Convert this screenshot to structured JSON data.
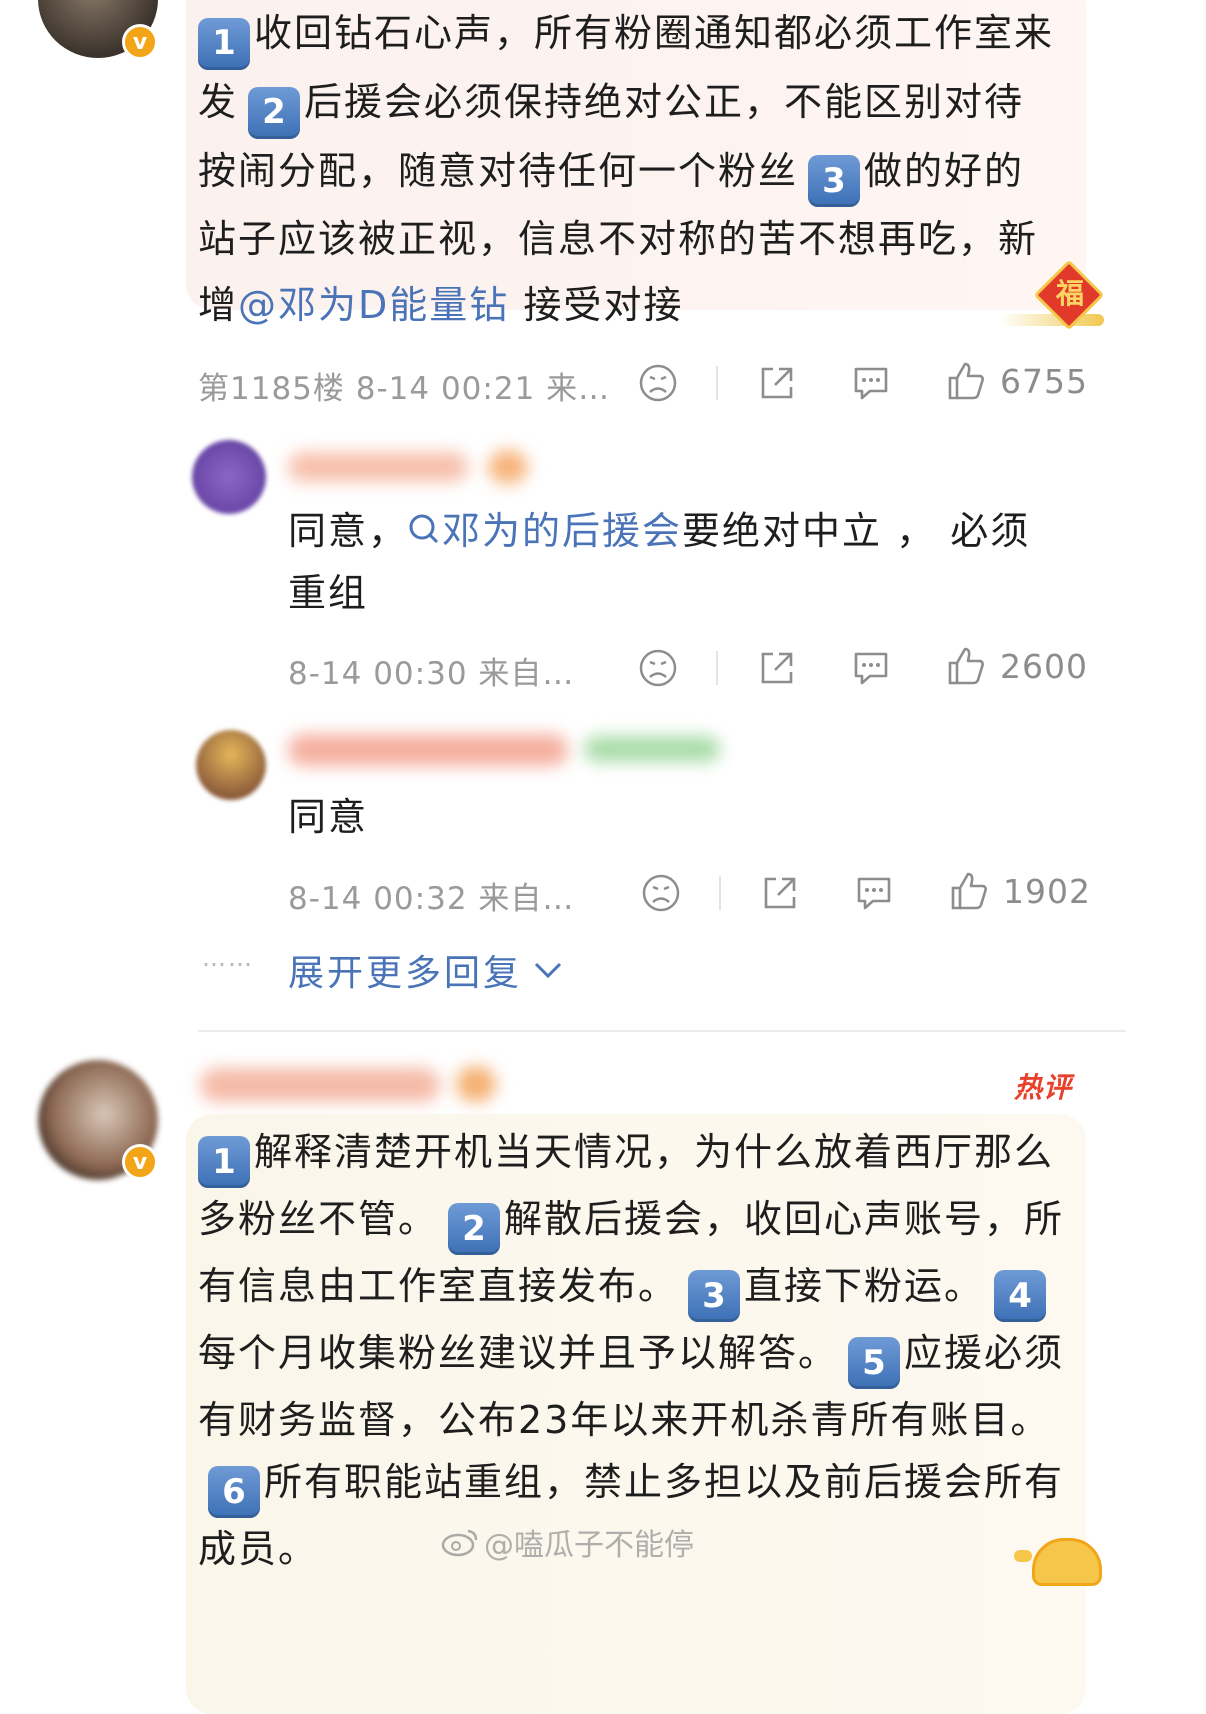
{
  "comment1": {
    "paragraphs": {
      "n1": "1",
      "t1": "收回钻石心声，所有粉圈通知都必须工作室来发",
      "n2": "2",
      "t2": "后援会必须保持绝对公正，不能区别对待按闹分配，随意对待任何一个粉丝",
      "n3": "3",
      "t3": "做的好的站子应该被正视，信息不对称的苦不想再吃，新增",
      "mention": "@邓为D能量钻",
      "t4": " 接受对接"
    },
    "meta": "第1185楼 8-14 00:21 来…",
    "likes": "6755",
    "sticker": "福"
  },
  "reply1": {
    "prefix": "同意，",
    "search_link": "邓为的后援会",
    "suffix": "要绝对中立 ，  必须重组",
    "meta": "8-14 00:30 来自…",
    "likes": "2600"
  },
  "reply2": {
    "text": "同意",
    "meta": "8-14 00:32 来自…",
    "likes": "1902"
  },
  "more_replies": {
    "dots": "……",
    "label": "展开更多回复"
  },
  "comment2": {
    "hot_badge": "热评",
    "paragraphs": {
      "n1": "1",
      "t1": "解释清楚开机当天情况，为什么放着西厅那么多粉丝不管。",
      "n2": "2",
      "t2": "解散后援会，收回心声账号，所有信息由工作室直接发布。",
      "n3": "3",
      "t3": "直接下粉运。",
      "n4": "4",
      "t4": "每个月收集粉丝建议并且予以解答。",
      "n5": "5",
      "t5": "应援必须有财务监督，公布23年以来开机杀青所有账目。",
      "n6": "6",
      "t6": "所有职能站重组，禁止多担以及前后援会所有成员。"
    }
  },
  "watermark": "@嗑瓜子不能停",
  "colors": {
    "link": "#4a74b7",
    "num_badge": "#4f80c3",
    "meta": "#9a9a9a",
    "hot": "#e8412b"
  }
}
